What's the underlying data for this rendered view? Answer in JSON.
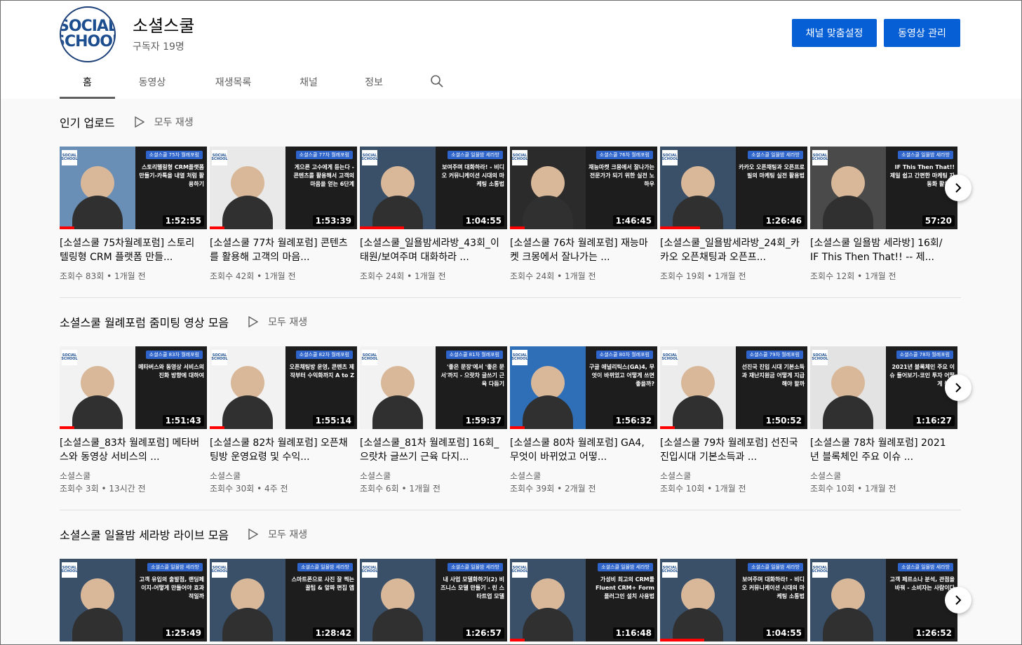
{
  "channel": {
    "avatar_text_1": "SOCIAL",
    "avatar_text_2": "SCHOOL",
    "name": "소셜스쿨",
    "subscribers": "구독자 19명"
  },
  "actions": {
    "customize": "채널 맞춤설정",
    "manage": "동영상 관리"
  },
  "tabs": [
    {
      "label": "홈",
      "active": true
    },
    {
      "label": "동영상",
      "active": false
    },
    {
      "label": "재생목록",
      "active": false
    },
    {
      "label": "채널",
      "active": false
    },
    {
      "label": "정보",
      "active": false
    }
  ],
  "shelves": [
    {
      "title": "인기 업로드",
      "play_all": "모두 재생",
      "videos": [
        {
          "title": "[소셜스쿨 75차월례포럼] 스토리텔링형 CRM 플랫폼 만들...",
          "duration": "1:52:55",
          "views": "조회수 83회",
          "age": "1개월 전",
          "tag": "소셜스쿨 75차 월례포럼",
          "headline": "스토리텔링형 CRM플랫폼 만들기-카톡을 내열 처럼 활용하기",
          "left_color": "#6a8fb6",
          "progress": 0.1
        },
        {
          "title": "[소셜스쿨 77차 월례포럼] 콘텐츠를 활용해 고객의 마음...",
          "duration": "1:53:39",
          "views": "조회수 42회",
          "age": "1개월 전",
          "tag": "소셜스쿨 77차 월례포럼",
          "headline": "게으른 고수에게 듣는다 - 콘텐츠를 활용해서 고객의 마음을 얻는 6단계",
          "left_color": "#e9e9e9",
          "progress": 0.1
        },
        {
          "title": "[소셜스쿨_일욜밤세라방_43회_이태원/보여주며 대화하라 ...",
          "duration": "1:04:55",
          "views": "조회수 24회",
          "age": "1개월 전",
          "tag": "소셜스쿨 일욜밤 세라방",
          "headline": "보여주며 대화하라! - 비디오 커뮤니케이션 시대의 마케팅 소통법",
          "left_color": "#3a5068",
          "progress": 0.3
        },
        {
          "title": "[소셜스쿨 76차 월례포럼] 재능마켓 크몽에서 잘나가는 ...",
          "duration": "1:46:45",
          "views": "조회수 24회",
          "age": "1개월 전",
          "tag": "소셜스쿨 76차 월례포럼",
          "headline": "재능마켓 크몽에서 잘나가는 전문가가 되기 위한 실전 노하우",
          "left_color": "#2b2b2b",
          "progress": 0.1
        },
        {
          "title": "[소셜스쿨_일욜밤세라방_24회_카카오 오픈채팅과 오픈프...",
          "duration": "1:26:46",
          "views": "조회수 19회",
          "age": "1개월 전",
          "tag": "소셜스쿨 일욜밤 세라방",
          "headline": "카카오 오픈채팅과 오픈프로필의 마케팅 실전 활용법",
          "left_color": "#3a5068",
          "progress": 0.27
        },
        {
          "title": "[소셜스쿨 일욜밤 세라방] 16회/ IF This Then That!! -- 제...",
          "duration": "57:20",
          "views": "조회수 12회",
          "age": "1개월 전",
          "tag": "소셜스쿨 일욜밤 세라방",
          "headline": "IF This Then That!! 제일 쉽고 간편한 마케팅 자동화 활용법",
          "left_color": "#4a4a4a",
          "progress": 0.0
        }
      ]
    },
    {
      "title": "소셜스쿨 월례포럼 줌미팅 영상 모음",
      "play_all": "모두 재생",
      "videos": [
        {
          "title": "[소셜스쿨_83차 월례포럼] 메타버스와 동영상 서비스의 ...",
          "duration": "1:51:43",
          "channel": "소셜스쿨",
          "views": "조회수 3회",
          "age": "13시간 전",
          "tag": "소셜스쿨 83차 월례포럼",
          "headline": "메타버스와 동영상 서비스의 진화 방향에 대하여",
          "left_color": "#f2f2f2",
          "progress": 0.1
        },
        {
          "title": "[소셜스쿨 82차 월례포럼] 오픈채팅방 운영요령 및 수익...",
          "duration": "1:55:14",
          "channel": "소셜스쿨",
          "views": "조회수 30회",
          "age": "4주 전",
          "tag": "소셜스쿨 82차 월례포럼",
          "headline": "오픈채팅방 운영, 콘텐츠 제작부터 수익화까지 A to Z",
          "left_color": "#f2f2f2",
          "progress": 0.1
        },
        {
          "title": "[소셜스쿨_81차 월례포럼] 16회_으랏차 글쓰기 근육 다지...",
          "duration": "1:59:37",
          "channel": "소셜스쿨",
          "views": "조회수 6회",
          "age": "1개월 전",
          "tag": "소셜스쿨 81차 월례포럼",
          "headline": "'좋은 문장'에서 '좋은 문서'까지 - 으랏차 글쓰기 근육 다듬기",
          "left_color": "#f2f2f2",
          "progress": 0.0
        },
        {
          "title": "[소셜스쿨 80차 월례포럼] GA4, 무엇이 바뀌었고 어떻...",
          "duration": "1:56:32",
          "channel": "소셜스쿨",
          "views": "조회수 39회",
          "age": "2개월 전",
          "tag": "소셜스쿨 80차 월례포럼",
          "headline": "구글 애널리틱스(GA)4, 무엇이 바뀌었고 어떻게 쓰면 좋을까?",
          "left_color": "#2f6fb7",
          "progress": 0.1
        },
        {
          "title": "[소셜스쿨 79차 월례포럼] 선진국 진입시대 기본소득과 ...",
          "duration": "1:50:52",
          "channel": "소셜스쿨",
          "views": "조회수 10회",
          "age": "1개월 전",
          "tag": "소셜스쿨 79차 월례포럼",
          "headline": "선진국 진입 시대 기본소득과 재난지원금 어떻게 지급해야 할까",
          "left_color": "#ececec",
          "progress": 0.1
        },
        {
          "title": "[소셜스쿨 78차 월례포럼] 2021년 블록체인 주요 이슈 ...",
          "duration": "1:16:27",
          "channel": "소셜스쿨",
          "views": "조회수 10회",
          "age": "1개월 전",
          "tag": "소셜스쿨 78차 월례포럼",
          "headline": "2021년 블록체인 주요 이슈 들어보기-코인 투자 어떻게 볼까",
          "left_color": "#e3e3e3",
          "progress": 0.0
        }
      ]
    },
    {
      "title": "소셜스쿨 일욜밤 세라방 라이브 모음",
      "play_all": "모두 재생",
      "videos": [
        {
          "duration": "1:25:49",
          "tag": "소셜스쿨 일욜밤 세라방",
          "headline": "고객 유입의 출발점, 랜딩페이지-어떻게 만들어야 효과적일까",
          "left_color": "#3a5068",
          "progress": 0.0
        },
        {
          "duration": "1:28:42",
          "tag": "소셜스쿨 일욜밤 세라방",
          "headline": "스마트폰으로 사진 잘 찍는 꿀팁 & 앞짜 편집 앱",
          "left_color": "#3a5068",
          "progress": 0.0
        },
        {
          "duration": "1:26:57",
          "tag": "소셜스쿨 일욜밤 세라방",
          "headline": "내 사업 모델화하기(2) 비즈니스 모델 만들기 - 린 스타트업 모델",
          "left_color": "#3a5068",
          "progress": 0.0
        },
        {
          "duration": "1:16:48",
          "tag": "소셜스쿨 일욜밤 세라방",
          "headline": "가성비 최고의 CRM툴 Fluent CRM+ Form 플러그인 설치 사용법",
          "left_color": "#3a5068",
          "progress": 0.1
        },
        {
          "duration": "1:04:55",
          "tag": "소셜스쿨 일욜밤 세라방",
          "headline": "보여주며 대화하라! - 비디오 커뮤니케이션 시대의 마케팅 소통법",
          "left_color": "#3a5068",
          "progress": 0.3
        },
        {
          "duration": "1:26:52",
          "tag": "소셜스쿨 일욜밤 세라방",
          "headline": "고객 페르소나 분석, 관점을 바꿔 - 소비자는 사람이다",
          "left_color": "#3a5068",
          "progress": 0.0
        }
      ]
    }
  ]
}
